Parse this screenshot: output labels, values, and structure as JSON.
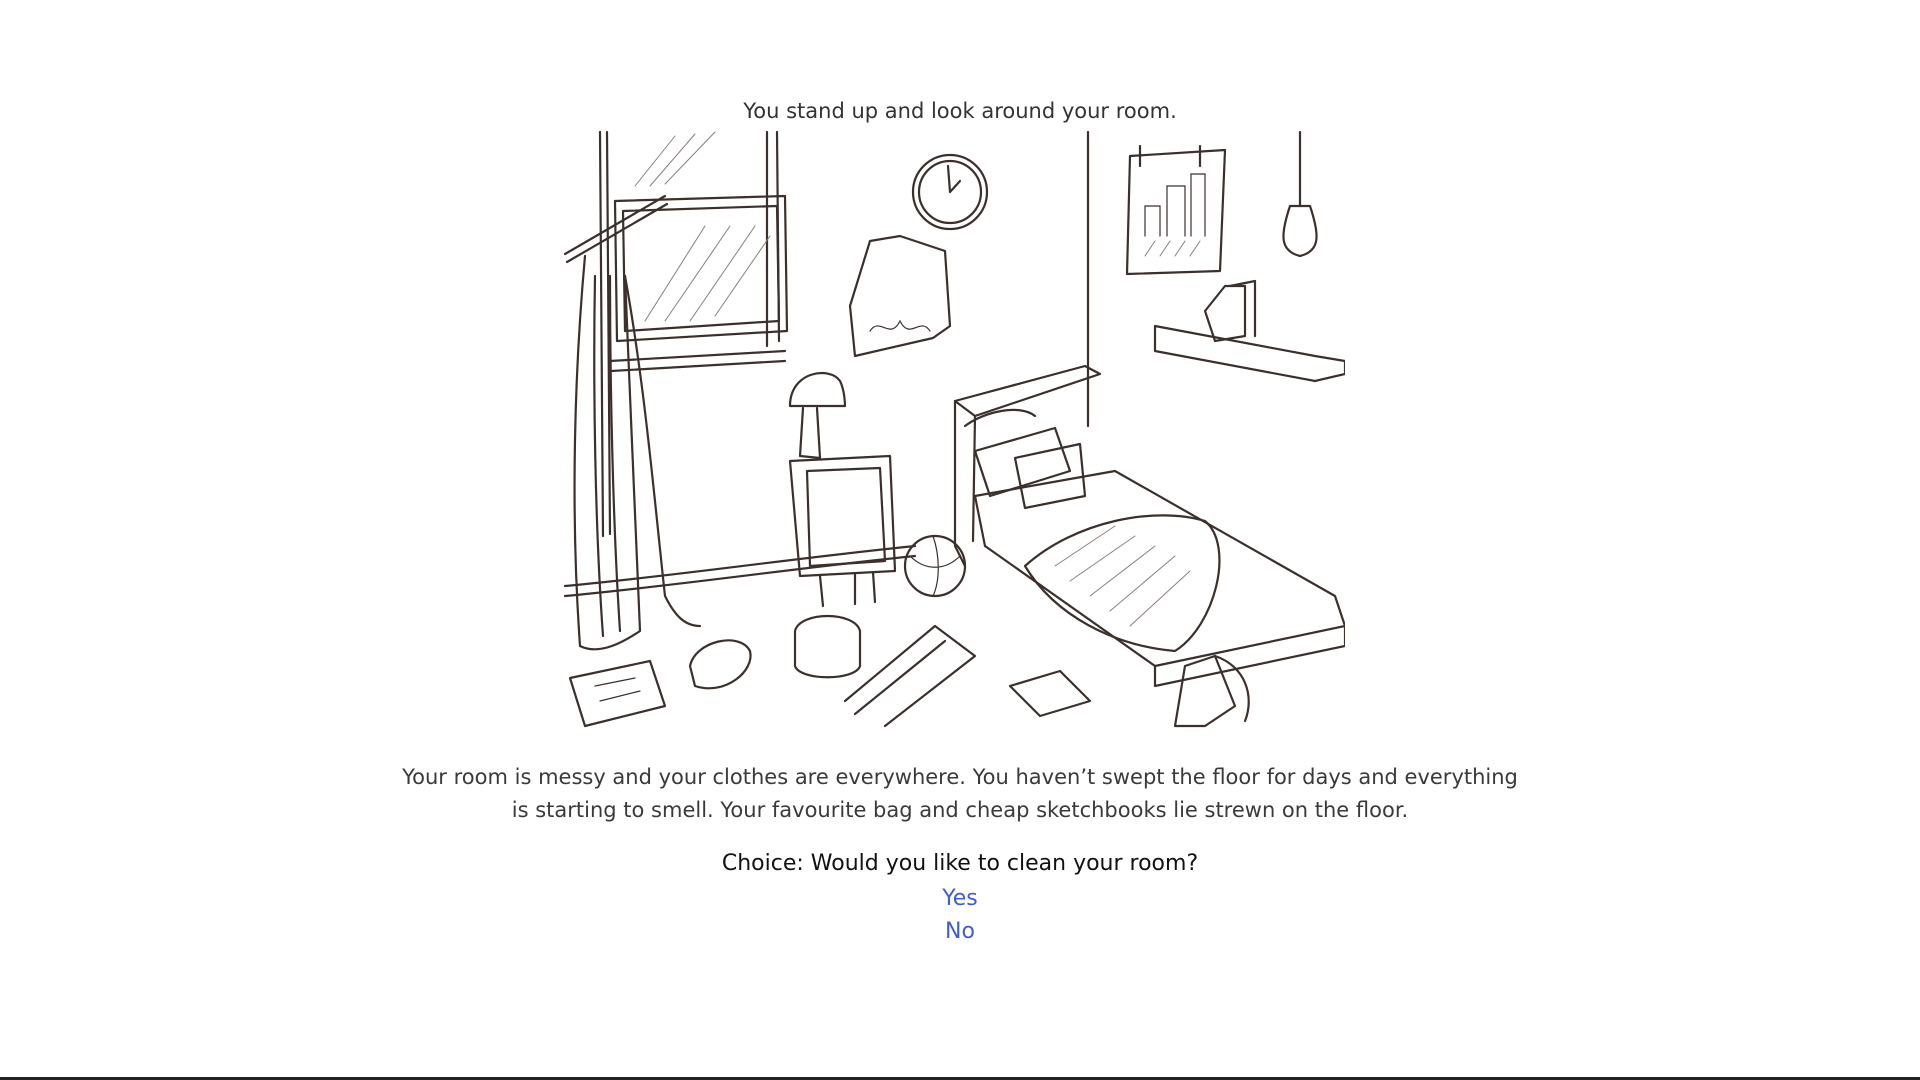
{
  "scene": {
    "intro_text": "You stand up and look around your room.",
    "illustration_subject": "messy-bedroom-sketch",
    "description": "Your room is messy and your clothes are everywhere. You haven’t swept the floor for days and everything is starting to smell. Your favourite bag and cheap sketchbooks lie strewn on the floor."
  },
  "choice": {
    "prompt": "Choice: Would you like to clean your room?",
    "options": [
      {
        "label": "Yes"
      },
      {
        "label": "No"
      }
    ]
  },
  "colors": {
    "text": "#3a3a3a",
    "prompt": "#111111",
    "link": "#3f5fcf",
    "sketch": "#3b302c"
  }
}
